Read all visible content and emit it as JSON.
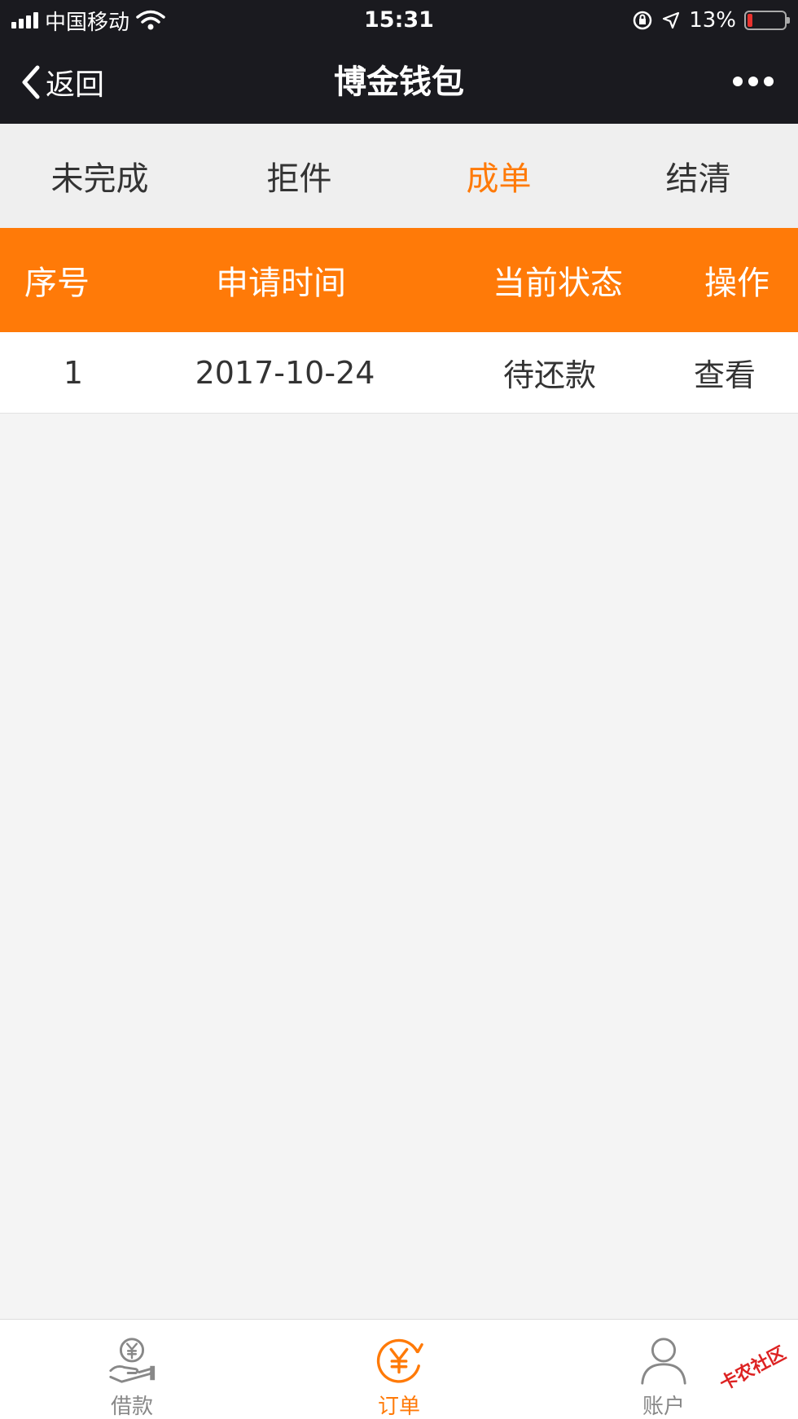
{
  "status_bar": {
    "carrier": "中国移动",
    "time": "15:31",
    "battery_percent": "13%",
    "battery_level": 0.13,
    "icons": [
      "signal-icon",
      "wifi-icon",
      "orientation-lock-icon",
      "location-icon",
      "battery-icon"
    ]
  },
  "nav": {
    "back_label": "返回",
    "title": "博金钱包",
    "more_icon": "more-icon"
  },
  "tabs": [
    {
      "label": "未完成",
      "active": false
    },
    {
      "label": "拒件",
      "active": false
    },
    {
      "label": "成单",
      "active": true
    },
    {
      "label": "结清",
      "active": false
    }
  ],
  "table": {
    "headers": [
      "序号",
      "申请时间",
      "当前状态",
      "操作"
    ],
    "rows": [
      {
        "index": "1",
        "date": "2017-10-24",
        "status": "待还款",
        "action": "查看"
      }
    ]
  },
  "tabbar": {
    "items": [
      {
        "label": "借款",
        "icon": "loan-hand-icon",
        "active": false
      },
      {
        "label": "订单",
        "icon": "order-yen-icon",
        "active": true
      },
      {
        "label": "账户",
        "icon": "user-icon",
        "active": false
      }
    ]
  },
  "watermark": "卡农社区",
  "colors": {
    "accent": "#ff7a08",
    "nav_bg": "#1a1a1f",
    "page_bg": "#f4f4f4",
    "battery_low": "#e8322e"
  }
}
